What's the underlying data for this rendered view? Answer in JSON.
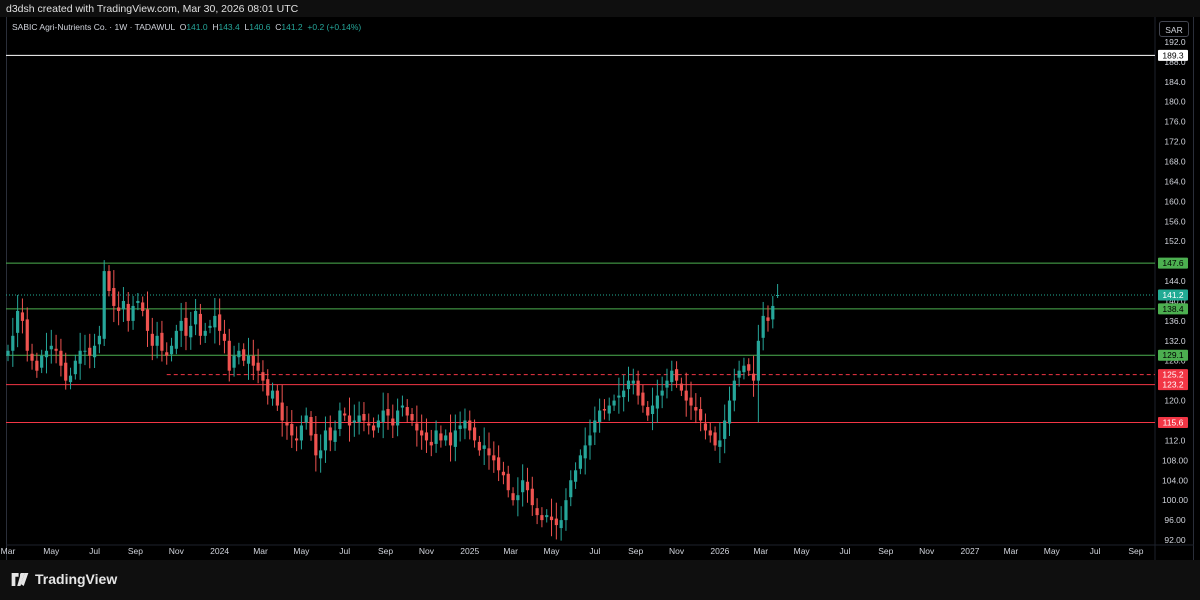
{
  "header": {
    "created_by": "d3dsh created with TradingView.com, Mar 30, 2026 08:01 UTC"
  },
  "legend": {
    "name": "SABIC Agri-Nutrients Co. · 1W · TADAWUL",
    "o_label": "O",
    "o": "141.0",
    "h_label": "H",
    "h": "143.4",
    "l_label": "L",
    "l": "140.6",
    "c_label": "C",
    "c": "141.2",
    "change": "+0.2 (+0.14%)"
  },
  "currency": "SAR",
  "footer": {
    "brand": "TradingView"
  },
  "colors": {
    "up": "#26a69a",
    "down": "#ef5350",
    "green_level": "#4caf50",
    "red_level": "#f23645",
    "white_level": "#ffffff",
    "teal_label": "#22ab94"
  },
  "chart_data": {
    "type": "candlestick",
    "interval": "1W",
    "ylim": [
      91,
      193
    ],
    "y_ticks": [
      "92.00",
      "96.00",
      "100.00",
      "104.00",
      "108.00",
      "112.0",
      "116.0",
      "120.0",
      "124.0",
      "128.0",
      "132.0",
      "136.0",
      "140.0",
      "144.0",
      "148.0",
      "152.0",
      "156.0",
      "160.0",
      "164.0",
      "168.0",
      "172.0",
      "176.0",
      "180.0",
      "184.0",
      "188.0",
      "192.0"
    ],
    "x_ticks": [
      {
        "label": "Mar",
        "t": 0
      },
      {
        "label": "May",
        "t": 9
      },
      {
        "label": "Jul",
        "t": 18
      },
      {
        "label": "Sep",
        "t": 26.5
      },
      {
        "label": "Nov",
        "t": 35
      },
      {
        "label": "2024",
        "t": 44
      },
      {
        "label": "Mar",
        "t": 52.5
      },
      {
        "label": "May",
        "t": 61
      },
      {
        "label": "Jul",
        "t": 70
      },
      {
        "label": "Sep",
        "t": 78.5
      },
      {
        "label": "Nov",
        "t": 87
      },
      {
        "label": "2025",
        "t": 96
      },
      {
        "label": "Mar",
        "t": 104.5
      },
      {
        "label": "May",
        "t": 113
      },
      {
        "label": "Jul",
        "t": 122
      },
      {
        "label": "Sep",
        "t": 130.5
      },
      {
        "label": "Nov",
        "t": 139
      },
      {
        "label": "2026",
        "t": 148
      },
      {
        "label": "Mar",
        "t": 156.5
      },
      {
        "label": "May",
        "t": 165
      },
      {
        "label": "Jul",
        "t": 174
      },
      {
        "label": "Sep",
        "t": 182.5
      },
      {
        "label": "Nov",
        "t": 191
      },
      {
        "label": "2027",
        "t": 200
      },
      {
        "label": "Mar",
        "t": 208.5
      },
      {
        "label": "May",
        "t": 217
      },
      {
        "label": "Jul",
        "t": 226
      },
      {
        "label": "Sep",
        "t": 234.5
      }
    ],
    "levels": [
      {
        "value": 189.3,
        "label": "189.3",
        "color": "#ffffff",
        "style": "solid",
        "text": "#000000"
      },
      {
        "value": 147.6,
        "label": "147.6",
        "color": "#4caf50",
        "style": "solid",
        "text": "#000000"
      },
      {
        "value": 141.2,
        "label": "141.2",
        "color": "#22ab94",
        "style": "dotted",
        "text": "#ffffff"
      },
      {
        "value": 138.4,
        "label": "138.4",
        "color": "#4caf50",
        "style": "solid",
        "text": "#000000"
      },
      {
        "value": 129.1,
        "label": "129.1",
        "color": "#4caf50",
        "style": "solid",
        "text": "#000000"
      },
      {
        "value": 125.2,
        "label": "125.2",
        "color": "#f23645",
        "style": "dashed",
        "text": "#ffffff"
      },
      {
        "value": 123.2,
        "label": "123.2",
        "color": "#f23645",
        "style": "solid",
        "text": "#ffffff"
      },
      {
        "value": 115.6,
        "label": "115.6",
        "color": "#f23645",
        "style": "solid",
        "text": "#ffffff"
      }
    ],
    "closes": [
      130,
      133,
      138,
      136,
      130,
      128,
      126,
      129,
      130,
      131,
      130,
      127,
      124,
      125,
      128,
      130,
      130,
      129,
      131,
      133,
      146,
      142,
      139,
      138,
      140,
      136,
      139,
      140,
      138,
      134,
      131,
      133,
      130,
      129,
      131,
      134,
      136,
      133,
      135,
      138,
      133,
      134,
      135,
      137,
      134,
      132,
      126,
      129,
      130,
      128,
      129,
      127,
      126,
      124,
      121,
      122,
      119,
      116,
      115,
      113,
      112,
      115,
      117,
      113,
      109,
      110,
      114,
      112,
      114,
      118,
      117,
      115,
      116,
      117,
      116,
      115,
      114,
      116,
      118,
      117,
      115,
      118,
      119,
      117,
      116,
      114,
      113,
      112,
      111,
      114,
      112,
      113,
      111,
      114,
      115,
      116,
      114,
      112,
      110,
      111,
      109,
      108,
      106,
      105,
      102,
      100,
      101,
      104,
      102,
      99,
      97,
      96,
      97,
      96,
      95,
      96,
      100,
      104,
      106,
      109,
      111,
      113,
      116,
      118,
      118,
      119,
      120,
      121,
      122,
      124,
      124,
      121,
      119,
      117,
      119,
      121,
      122,
      124,
      126,
      124,
      122,
      120,
      119,
      118,
      116,
      114,
      113,
      111,
      112,
      116,
      120,
      124,
      126,
      127,
      126,
      124,
      132,
      137,
      136,
      139,
      141.2
    ]
  }
}
